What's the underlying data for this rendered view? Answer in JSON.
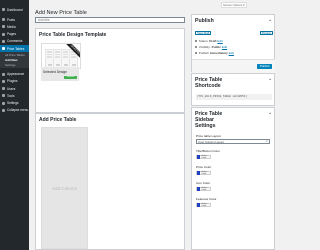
{
  "sidebar": {
    "items": [
      {
        "label": "Dashboard",
        "icon": "dashboard-icon"
      },
      {
        "label": "Posts",
        "icon": "posts-icon"
      },
      {
        "label": "Media",
        "icon": "media-icon"
      },
      {
        "label": "Pages",
        "icon": "pages-icon"
      },
      {
        "label": "Comments",
        "icon": "comments-icon"
      },
      {
        "label": "Price Tables",
        "icon": "price-tables-icon",
        "active": true
      }
    ],
    "submenu": [
      {
        "label": "All Price Tables"
      },
      {
        "label": "Add New",
        "current": true
      },
      {
        "label": "Settings"
      }
    ],
    "items_after": [
      {
        "label": "Appearance",
        "icon": "appearance-icon"
      },
      {
        "label": "Plugins",
        "icon": "plugins-icon"
      },
      {
        "label": "Users",
        "icon": "users-icon"
      },
      {
        "label": "Tools",
        "icon": "tools-icon"
      },
      {
        "label": "Settings",
        "icon": "settings-icon"
      },
      {
        "label": "Collapse menu",
        "icon": "collapse-icon"
      }
    ]
  },
  "header": {
    "screen_options": "Screen Options ▾",
    "title": "Add New Price Table",
    "title_input_placeholder": "Add title"
  },
  "template_box": {
    "heading": "Price Table Design Template",
    "ribbon": "SELECTED",
    "selected_label": "Selected Design",
    "button_label": "Selected"
  },
  "add_box": {
    "heading": "Add Price Table",
    "add_column_label": "Add Column"
  },
  "publish": {
    "heading": "Publish",
    "save_draft": "Save Draft",
    "preview": "Preview",
    "status_label": "Status:",
    "status_value": "Draft",
    "visibility_label": "Visibility:",
    "visibility_value": "Public",
    "publish_when_label": "Publish",
    "publish_when_value": "immediately",
    "edit_link": "Edit",
    "publish_button": "Publish"
  },
  "shortcode": {
    "heading_line1": "Price Table",
    "heading_line2": "Shortcode",
    "code": "[TPL_ECLS_PRICE_TABLE id=10551]"
  },
  "settings": {
    "heading_line1": "Price Table",
    "heading_line2": "Sidebar",
    "heading_line3": "Settings",
    "layout_label": "Price table Layout",
    "layout_value": "Four Column Layout",
    "fields": [
      {
        "label": "Title/Button Color",
        "color": "#1e3fbf",
        "button_text": "Select Color"
      },
      {
        "label": "Price Color",
        "color": "#1e3fbf",
        "button_text": "Select Color"
      },
      {
        "label": "Icon Color",
        "color": "#1e3fbf",
        "button_text": "Select Color"
      },
      {
        "label": "Features Color",
        "color": "#1e3fbf",
        "button_text": "Select Color"
      }
    ]
  },
  "colors": {
    "admin_bar": "#23282d",
    "accent": "#0073aa",
    "primary_button": "#0085ba",
    "selected_button": "#3fb04d"
  }
}
